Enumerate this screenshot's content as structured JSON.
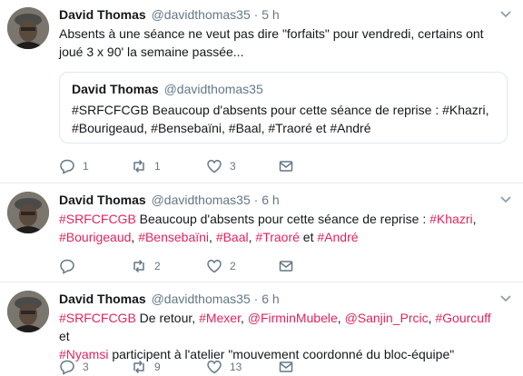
{
  "tweets": [
    {
      "author_name": "David Thomas",
      "author_handle": "@davidthomas35",
      "separator": "·",
      "time": "5 h",
      "text_line1": "Absents à une séance ne veut pas dire \"forfaits\" pour vendredi, certains ont",
      "text_line2": "joué 3 x 90' la semaine passée...",
      "quote": {
        "author_name": "David Thomas",
        "author_handle": "@davidthomas35",
        "text_line1": "#SRFCFCGB Beaucoup d'absents pour cette séance de reprise : #Khazri,",
        "text_line2": "#Bourigeaud, #Bensebaïni, #Baal, #Traoré et #André"
      },
      "reply_count": "1",
      "retweet_count": "1",
      "like_count": "3"
    },
    {
      "author_name": "David Thomas",
      "author_handle": "@davidthomas35",
      "separator": "·",
      "time": "6 h",
      "parts": {
        "h1": "#SRFCFCGB",
        "t1": " Beaucoup d'absents pour cette séance de reprise : ",
        "h2": "#Khazri",
        "t2": ",",
        "h3": "#Bourigeaud",
        "t3": ", ",
        "h4": "#Bensebaïni",
        "t4": ", ",
        "h5": "#Baal",
        "t5": ", ",
        "h6": "#Traoré",
        "t6": " et ",
        "h7": "#André"
      },
      "reply_count": "",
      "retweet_count": "2",
      "like_count": "2"
    },
    {
      "author_name": "David Thomas",
      "author_handle": "@davidthomas35",
      "separator": "·",
      "time": "6 h",
      "parts": {
        "h1": "#SRFCFCGB",
        "t1": " De retour, ",
        "h2": "#Mexer",
        "t2": ", ",
        "h3": "@FirminMubele",
        "t3": ", ",
        "h4": "@Sanjin_Prcic",
        "t4": ", ",
        "h5": "#Gourcuff",
        "t5": " et",
        "h6": "#Nyamsi",
        "t6": " participent à l'atelier \"mouvement coordonné du bloc-équipe\""
      },
      "reply_count": "3",
      "retweet_count": "9",
      "like_count": "13"
    }
  ],
  "icons": {
    "reply": "reply-icon",
    "retweet": "retweet-icon",
    "like": "heart-icon",
    "dm": "envelope-icon",
    "more": "chevron-down-icon"
  },
  "colors": {
    "hashtag": "#e0245e",
    "secondary_text": "#657786",
    "divider": "#e6ecf0"
  }
}
